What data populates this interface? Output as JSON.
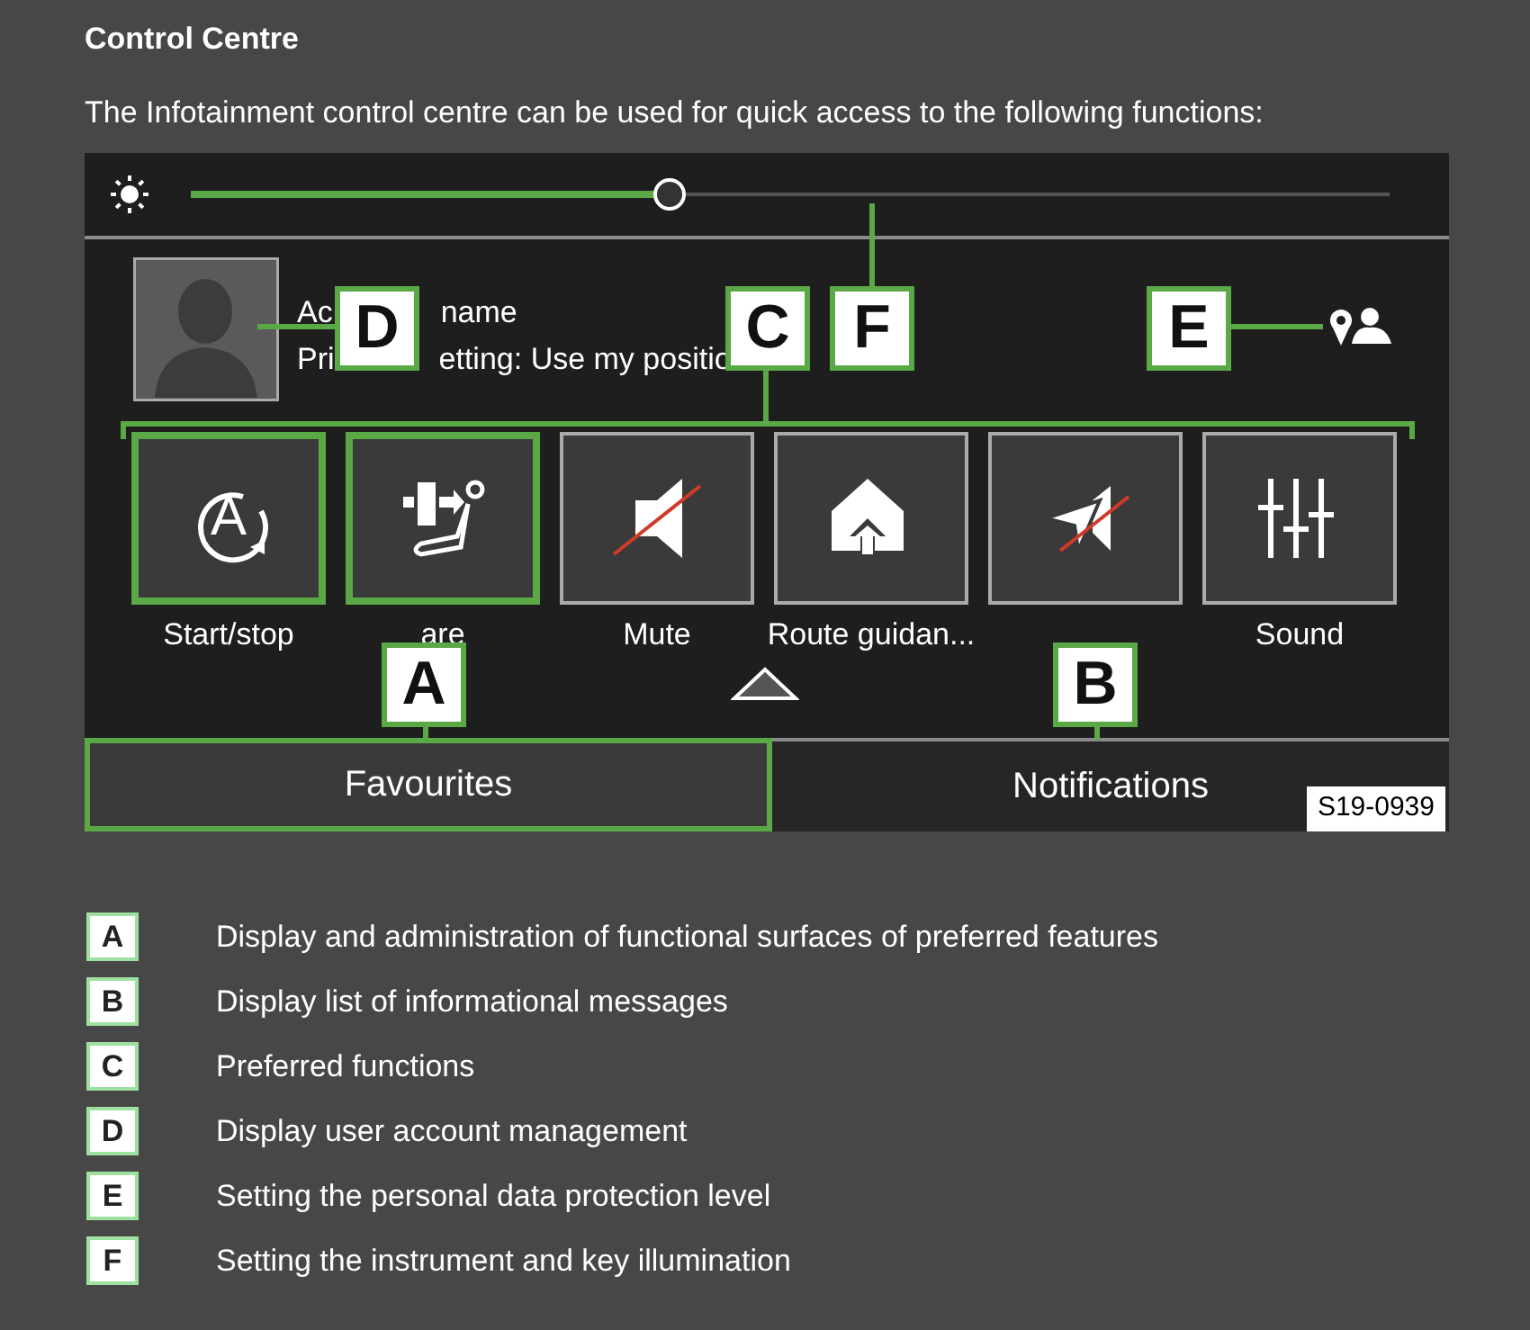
{
  "heading": "Control Centre",
  "intro": "The Infotainment control centre can be used for quick access to the following functions:",
  "screen": {
    "brightness": {
      "level": 0.4
    },
    "account": {
      "name_parts": [
        "Ac",
        "name"
      ],
      "privacy_parts": [
        "Pri",
        "etting: Use my positio"
      ]
    },
    "tiles": [
      {
        "kind": "start-stop",
        "icon_text": "A",
        "label": "Start/stop",
        "highlighted": true
      },
      {
        "kind": "climate",
        "label": "are",
        "highlighted": true
      },
      {
        "kind": "mute",
        "label": "Mute",
        "highlighted": false
      },
      {
        "kind": "home",
        "label": "Route guidan...",
        "highlighted": false
      },
      {
        "kind": "nav-mute",
        "highlighted": false
      },
      {
        "kind": "sound",
        "label": "Sound",
        "highlighted": false
      }
    ],
    "tabs": [
      {
        "label": "Favourites",
        "selected": true
      },
      {
        "label": "Notifications",
        "selected": false
      }
    ],
    "figure_code": "S19-0939",
    "callouts": [
      {
        "letter": "D"
      },
      {
        "letter": "C"
      },
      {
        "letter": "F"
      },
      {
        "letter": "E"
      },
      {
        "letter": "A"
      },
      {
        "letter": "B"
      }
    ]
  },
  "legend": [
    {
      "letter": "A",
      "text": "Display and administration of functional surfaces of preferred features"
    },
    {
      "letter": "B",
      "text": "Display list of informational messages"
    },
    {
      "letter": "C",
      "text": "Preferred functions"
    },
    {
      "letter": "D",
      "text": "Display user account management"
    },
    {
      "letter": "E",
      "text": "Setting the personal data protection level"
    },
    {
      "letter": "F",
      "text": "Setting the instrument and key illumination"
    }
  ]
}
